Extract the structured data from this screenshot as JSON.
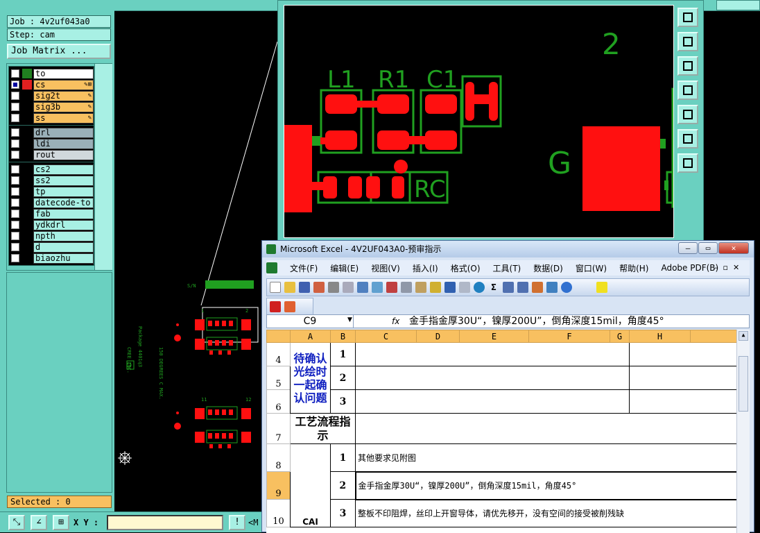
{
  "job": {
    "label": "Job : 4v2uf043a0",
    "step": "Step: cam",
    "matrix_button": "Job Matrix ..."
  },
  "layers_group1": [
    {
      "name": "to",
      "color": "#208020",
      "bg": "#ffffff",
      "checked": false,
      "edit": ""
    },
    {
      "name": "cs",
      "color": "#e02020",
      "bg": "#f8c060",
      "checked": true,
      "edit": "✎⊞"
    },
    {
      "name": "sig2t",
      "color": "#000000",
      "bg": "#f8c060",
      "checked": false,
      "edit": "✎"
    },
    {
      "name": "sig3b",
      "color": "#000000",
      "bg": "#f8c060",
      "checked": false,
      "edit": "✎"
    },
    {
      "name": "ss",
      "color": "#000000",
      "bg": "#f8c060",
      "checked": false,
      "edit": "✎"
    }
  ],
  "layers_group2": [
    {
      "name": "drl",
      "color": "#000000",
      "bg": "#9ab0b8",
      "checked": false,
      "edit": ""
    },
    {
      "name": "ldi",
      "color": "#000000",
      "bg": "#9ab0b8",
      "checked": false,
      "edit": ""
    },
    {
      "name": "rout",
      "color": "#000000",
      "bg": "#d0d8dc",
      "checked": false,
      "edit": ""
    }
  ],
  "layers_group3": [
    {
      "name": "cs2",
      "color": "#000000",
      "bg": "#a8f0e4",
      "checked": false,
      "edit": ""
    },
    {
      "name": "ss2",
      "color": "#000000",
      "bg": "#a8f0e4",
      "checked": false,
      "edit": ""
    },
    {
      "name": "tp",
      "color": "#000000",
      "bg": "#a8f0e4",
      "checked": false,
      "edit": ""
    },
    {
      "name": "datecode-to",
      "color": "#000000",
      "bg": "#a8f0e4",
      "checked": false,
      "edit": ""
    },
    {
      "name": "fab",
      "color": "#000000",
      "bg": "#a8f0e4",
      "checked": false,
      "edit": ""
    },
    {
      "name": "ydkdrl",
      "color": "#000000",
      "bg": "#a8f0e4",
      "checked": false,
      "edit": ""
    },
    {
      "name": "npth",
      "color": "#000000",
      "bg": "#a8f0e4",
      "checked": false,
      "edit": ""
    },
    {
      "name": "d",
      "color": "#000000",
      "bg": "#a8f0e4",
      "checked": false,
      "edit": ""
    },
    {
      "name": "biaozhu",
      "color": "#000000",
      "bg": "#a8f0e4",
      "checked": false,
      "edit": ""
    }
  ],
  "selected": "Selected : 0",
  "xy_label": "X Y :",
  "bottom_trunc": "<M",
  "canvas": {
    "sn": "S/N",
    "package_text": "Package 4401q3",
    "degrees_text": "150 DEGREES C MAX.",
    "cree_text": "CREE INC.",
    "small_labels": [
      "1",
      "2",
      "11",
      "12"
    ]
  },
  "zoom": {
    "labels": [
      "L1",
      "R1",
      "C1",
      "RC",
      "G",
      "2"
    ]
  },
  "excel": {
    "title": "Microsoft Excel - 4V2UF043A0-预审指示",
    "menu": [
      "文件(F)",
      "编辑(E)",
      "视图(V)",
      "插入(I)",
      "格式(O)",
      "工具(T)",
      "数据(D)",
      "窗口(W)",
      "帮助(H)",
      "Adobe PDF(B)"
    ],
    "name_box": "C9",
    "fx": "fx",
    "formula": "金手指金厚30U“，镍厚200U”，倒角深度15mil，角度45°",
    "columns": [
      "A",
      "B",
      "C",
      "D",
      "E",
      "F",
      "G",
      "H"
    ],
    "rows": [
      "4",
      "5",
      "6",
      "7",
      "8",
      "9",
      "10"
    ],
    "group_a": "待确认光绘时一起确认问题",
    "process": "工艺流程指示",
    "nums": [
      "1",
      "2",
      "3",
      "1",
      "2",
      "3"
    ],
    "line1": "其他要求见附图",
    "line2": "金手指金厚30U“，镍厚200U”，倒角深度15mil，角度45°",
    "line3": "整板不印阻焊，丝印上开窗导体，请优先移开，没有空间的接受被削残缺",
    "partial_a": "CAI"
  },
  "colors": {
    "panel": "#6ad0c0",
    "selected": "#f8c060",
    "pad": "#ff1010",
    "outline": "#20a020"
  }
}
